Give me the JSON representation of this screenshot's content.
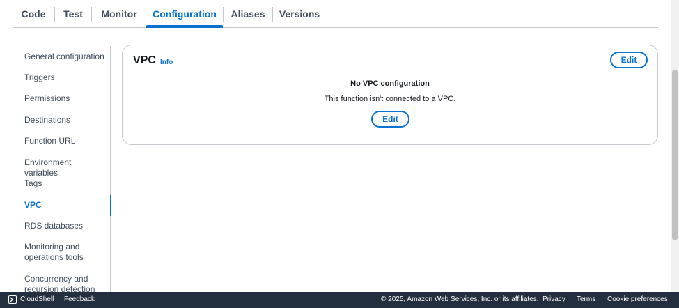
{
  "tabs": [
    {
      "label": "Code"
    },
    {
      "label": "Test"
    },
    {
      "label": "Monitor"
    },
    {
      "label": "Configuration",
      "active": true
    },
    {
      "label": "Aliases"
    },
    {
      "label": "Versions"
    }
  ],
  "sidenav": {
    "items": [
      {
        "label": "General configuration"
      },
      {
        "label": "Triggers"
      },
      {
        "label": "Permissions"
      },
      {
        "label": "Destinations"
      },
      {
        "label": "Function URL"
      },
      {
        "label": "Environment variables"
      },
      {
        "label": "Tags"
      },
      {
        "label": "VPC",
        "active": true
      },
      {
        "label": "RDS databases"
      },
      {
        "label": "Monitoring and operations tools"
      },
      {
        "label": "Concurrency and recursion detection"
      }
    ]
  },
  "vpc_panel": {
    "title": "VPC",
    "info_label": "Info",
    "edit_label": "Edit",
    "empty_title": "No VPC configuration",
    "empty_description": "This function isn't connected to a VPC.",
    "empty_edit_label": "Edit"
  },
  "footer": {
    "cloudshell_label": "CloudShell",
    "feedback_label": "Feedback",
    "copyright": "© 2025, Amazon Web Services, Inc. or its affiliates.",
    "privacy_label": "Privacy",
    "terms_label": "Terms",
    "cookie_label": "Cookie preferences"
  },
  "colors": {
    "accent": "#0972d3",
    "footer_bg": "#232f3e",
    "text": "#16191f",
    "border": "#c6c6cd"
  }
}
